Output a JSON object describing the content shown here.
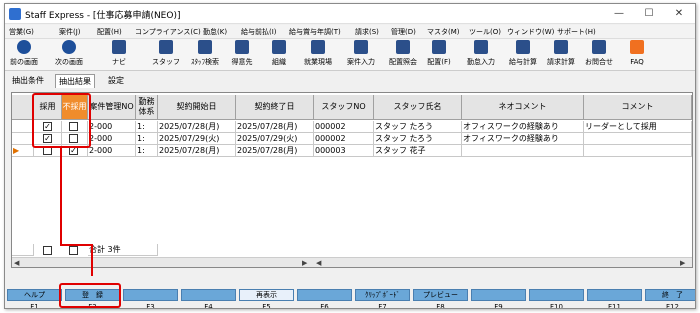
{
  "window": {
    "title": "Staff Express - [仕事応募申請(NEO)]",
    "minimize": "—",
    "maximize": "☐",
    "close": "✕"
  },
  "menu": [
    "営業(G)",
    "案件(J)",
    "配置(H)",
    "コンプライアンス(C)",
    "勤怠(K)",
    "給与前払(I)",
    "給与賞与年調(T)",
    "請求(S)",
    "管理(D)",
    "マスタ(M)",
    "ツール(O)",
    "ウィンドウ(W)",
    "サポート(H)"
  ],
  "toolbar": [
    "前の画面",
    "次の画面",
    "ナビ",
    "スタッフ",
    "ｽﾀｯﾌ検索",
    "得意先",
    "組織",
    "就業現場",
    "案件入力",
    "配置照会",
    "配置(F)",
    "勤怠入力",
    "給与計算",
    "請求計算",
    "お問合せ",
    "FAQ"
  ],
  "tabs": [
    "抽出条件",
    "抽出結果",
    "設定"
  ],
  "columns": [
    "採用",
    "不採用",
    "案件管理NO",
    "勤務体系",
    "契約開始日",
    "契約終了日",
    "スタッフNO",
    "スタッフ氏名",
    "ネオコメント",
    "コメント"
  ],
  "rows": [
    {
      "adopt": true,
      "reject": false,
      "case_no": "2-000",
      "shift": "1:",
      "start": "2025/07/28(月)",
      "end": "2025/07/28(月)",
      "staff_no": "000002",
      "staff_name": "スタッフ たろう",
      "neo_comment": "オフィスワークの経験あり",
      "comment": "リーダーとして採用"
    },
    {
      "adopt": true,
      "reject": false,
      "case_no": "2-000",
      "shift": "1:",
      "start": "2025/07/29(火)",
      "end": "2025/07/29(火)",
      "staff_no": "000002",
      "staff_name": "スタッフ たろう",
      "neo_comment": "オフィスワークの経験あり",
      "comment": ""
    },
    {
      "adopt": false,
      "reject": true,
      "case_no": "2-000",
      "shift": "1:",
      "start": "2025/07/28(月)",
      "end": "2025/07/28(月)",
      "staff_no": "000003",
      "staff_name": "スタッフ 花子",
      "neo_comment": "",
      "comment": ""
    }
  ],
  "footer": {
    "total": "合計 3件"
  },
  "fkeys": [
    {
      "label": "ヘルプ",
      "key": "F1"
    },
    {
      "label": "登　録",
      "key": "F2"
    },
    {
      "label": "",
      "key": "F3"
    },
    {
      "label": "",
      "key": "F4"
    },
    {
      "label": "再表示",
      "key": "F5"
    },
    {
      "label": "",
      "key": "F6"
    },
    {
      "label": "ｸﾘｯﾌﾟﾎﾞｰﾄﾞ",
      "key": "F7"
    },
    {
      "label": "プレビュー",
      "key": "F8"
    },
    {
      "label": "",
      "key": "F9"
    },
    {
      "label": "",
      "key": "F10"
    },
    {
      "label": "",
      "key": "F11"
    },
    {
      "label": "終　了",
      "key": "F12"
    }
  ]
}
